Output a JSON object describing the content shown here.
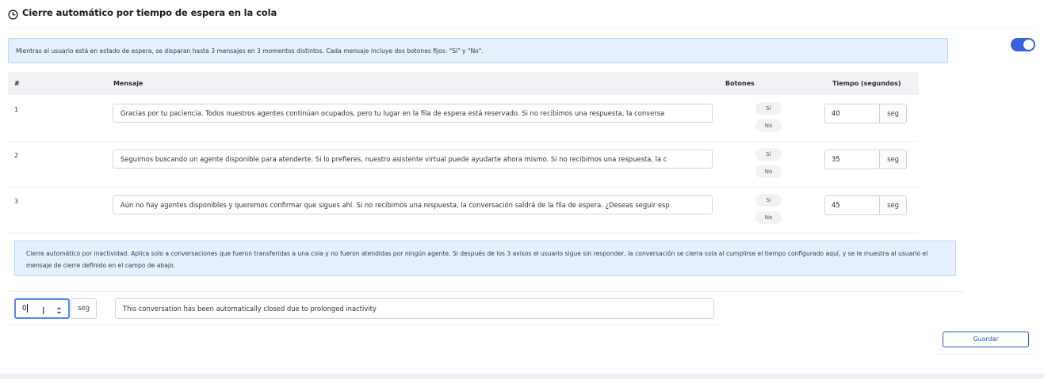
{
  "header": {
    "title": "Cierre automático por tiempo de espera en la cola",
    "icon": "clock-icon",
    "toggle_on": true,
    "toggle_color": "#3b63d9"
  },
  "info_top": "Mientras el usuario está en estado de espera, se disparan hasta 3 mensajes en 3 momentos distintos. Cada mensaje incluye dos botones fijos: \"Sí\" y \"No\".",
  "table": {
    "headers": {
      "num": "#",
      "message": "Mensaje",
      "buttons": "Botones",
      "time": "Tiempo (segundos)"
    },
    "rows": [
      {
        "num": "1",
        "message": "Gracias por tu paciencia. Todos nuestros agentes continúan ocupados, pero tu lugar en la fila de espera está reservado. Si no recibimos una respuesta, la conversa",
        "yes": "Sí",
        "no": "No",
        "seconds": "40",
        "unit": "seg"
      },
      {
        "num": "2",
        "message": "Seguimos buscando un agente disponible para atenderte. Si lo prefieres, nuestro asistente virtual puede ayudarte ahora mismo. Si no recibimos una respuesta, la c",
        "yes": "Sí",
        "no": "No",
        "seconds": "35",
        "unit": "seg"
      },
      {
        "num": "3",
        "message": "Aún no hay agentes disponibles y queremos confirmar que sigues ahí. Si no recibimos una respuesta, la conversación saldrá de la fila de espera. ¿Deseas seguir esp",
        "yes": "Sí",
        "no": "No",
        "seconds": "45",
        "unit": "seg"
      }
    ]
  },
  "info_mid": "Cierre automático por inactividad. Aplica solo a conversaciones que fueron transferidas a una cola y no fueron atendidas por ningún agente. Si después de los 3 avisos el usuario sigue sin responder, la conversación se cierra sola al cumplirse el tiempo configurado aquí, y se le muestra al usuario el mensaje de cierre definido en el campo de abajo.",
  "close": {
    "seconds": "0",
    "unit": "seg",
    "message": "This conversation has been automatically closed due to prolonged inactivity"
  },
  "save_label": "Guardar",
  "colors": {
    "accent": "#3b63d9",
    "info_bg": "#e5f0fc",
    "info_border": "#b9d8f5"
  }
}
